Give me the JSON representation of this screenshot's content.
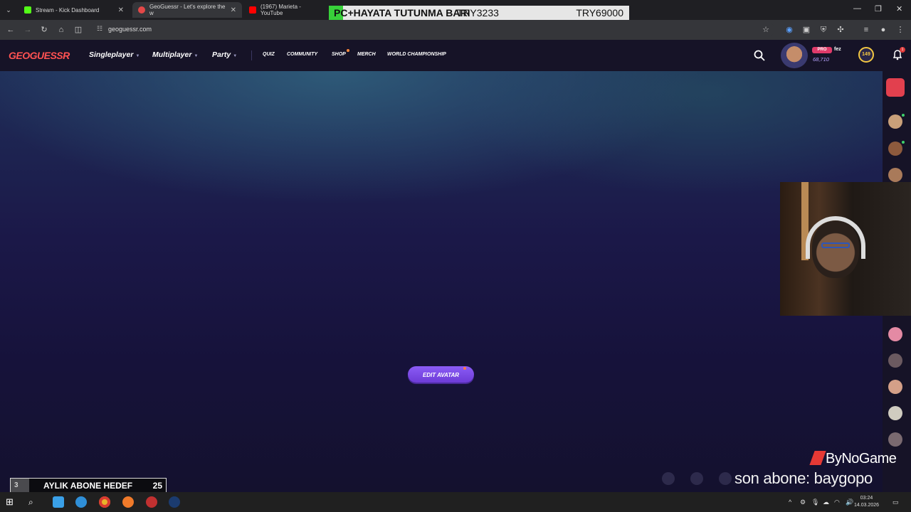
{
  "browser": {
    "tabs": [
      {
        "title": "Stream - Kick Dashboard",
        "favicon_color": "#53fc18"
      },
      {
        "title": "GeoGuessr - Let's explore the w",
        "favicon_color": "#e34848"
      },
      {
        "title": "(1967) Marieta - YouTube",
        "favicon_color": "#ff0000"
      }
    ],
    "url": "geoguessr.com"
  },
  "donation_goal": {
    "label": "PC+HAYATA TUTUNMA BARI",
    "current": "TRY3233",
    "target": "TRY69000",
    "progress": 0.047
  },
  "site": {
    "logo": "GEOGUESSR",
    "nav": [
      {
        "label": "Singleplayer"
      },
      {
        "label": "Multiplayer"
      },
      {
        "label": "Party"
      }
    ],
    "subnav": [
      {
        "label": "QUIZ"
      },
      {
        "label": "COMMUNITY"
      },
      {
        "label": "SHOP"
      },
      {
        "label": "MERCH"
      },
      {
        "label": "WORLD CHAMPIONSHIP"
      }
    ],
    "user": {
      "badge": "PRO",
      "name": "fez",
      "xp": "68,710",
      "level": "149",
      "notifications": "1"
    },
    "edit_avatar_label": "EDIT AVATAR"
  },
  "overlay": {
    "sub_goal": {
      "label": "AYLIK ABONE HEDEF",
      "current": "3",
      "target": "25"
    },
    "brand": "ByNoGame",
    "last_sub": "son abone: baygopo"
  },
  "taskbar": {
    "time": "03:24",
    "date": "14.03.2026"
  },
  "colors": {
    "accent_purple": "#7c3aed",
    "logo_red": "#ff5252",
    "goal_fill": "#38d13a"
  }
}
